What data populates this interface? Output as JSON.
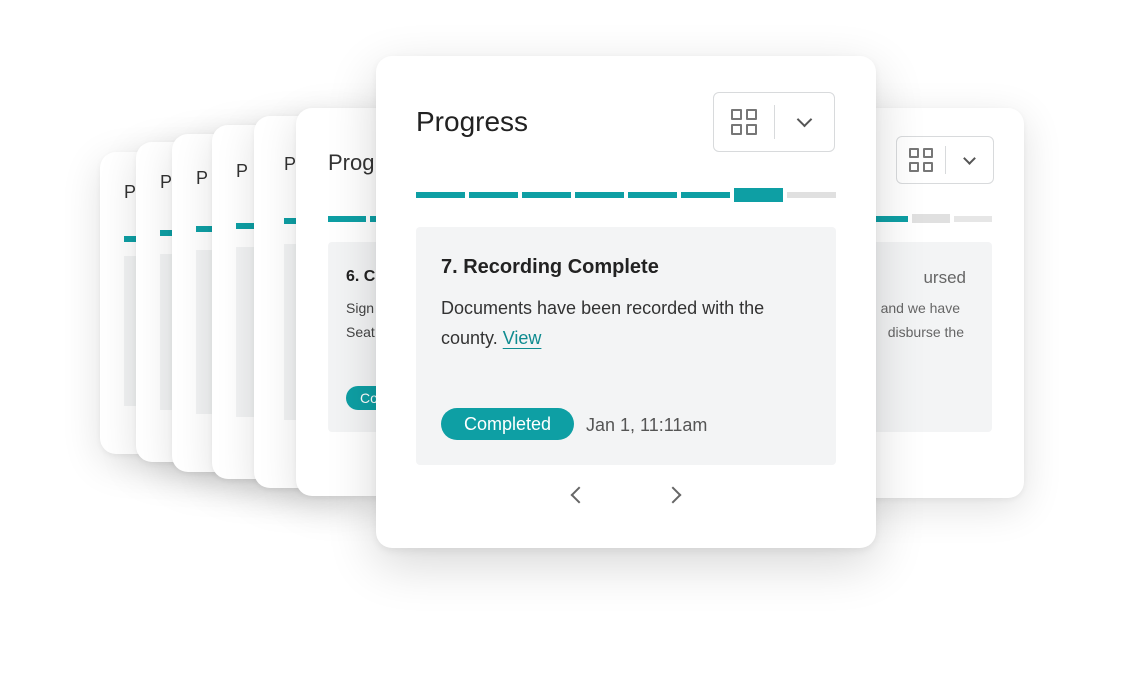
{
  "widget": {
    "title": "Progress",
    "short_title": "Prog",
    "initial": "P",
    "accent_color": "#0e9fa4",
    "track_color": "#e0e0e0",
    "layout_icon": "grid-view-icon",
    "dropdown_icon": "chevron-down-icon",
    "progress": {
      "total_steps": 8,
      "completed_steps": 7,
      "current_step": 7
    }
  },
  "current_step": {
    "title": "7. Recording Complete",
    "description": "Documents have been recorded with the county.",
    "link_label": "View",
    "status": "Completed",
    "timestamp": "Jan 1, 11:11am"
  },
  "previous_step": {
    "title_partial": "6. C",
    "desc_line1_partial": "Sign",
    "desc_line2_partial": "Seat",
    "status_partial": "Co"
  },
  "next_step": {
    "title_partial": "ursed",
    "desc_line1_partial": "and we have",
    "desc_line2_partial": "disburse the"
  },
  "navigation": {
    "prev_icon": "chevron-left-icon",
    "next_icon": "chevron-right-icon"
  }
}
